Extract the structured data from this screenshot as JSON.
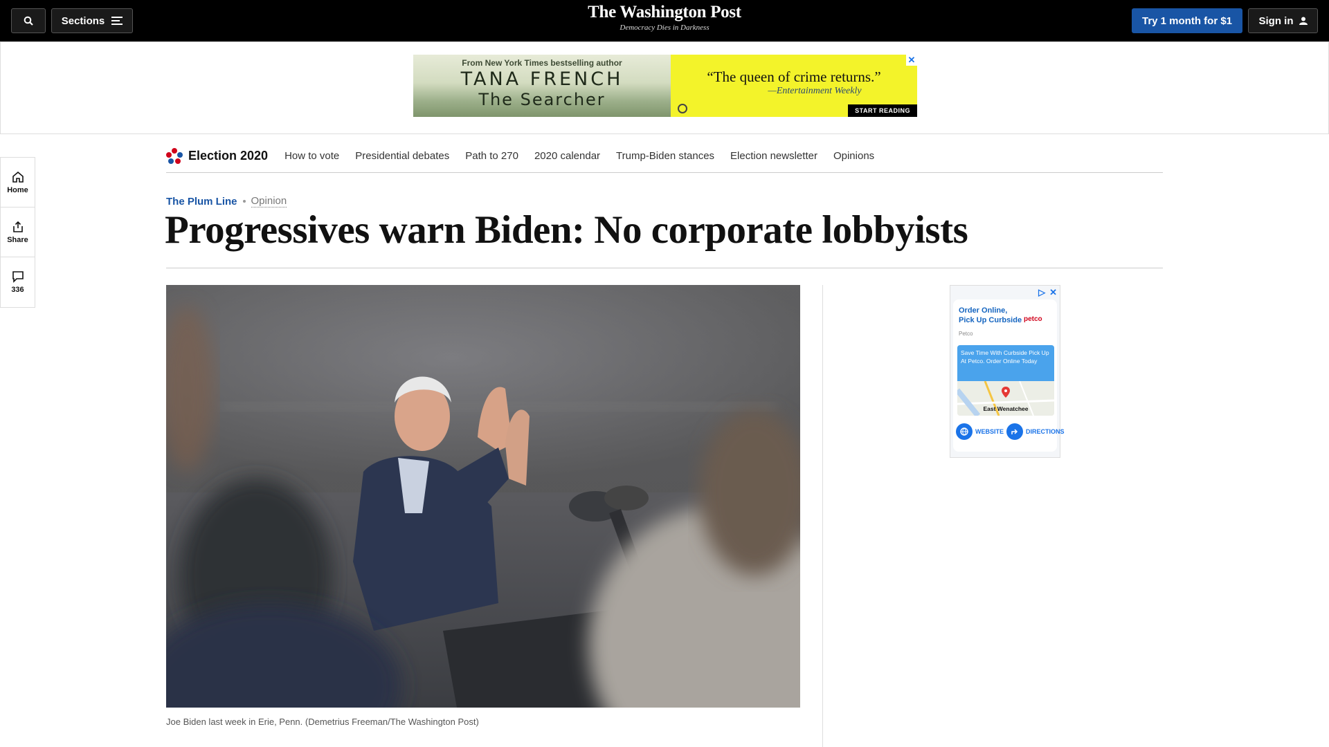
{
  "topbar": {
    "sections_label": "Sections",
    "logo": "The Washington Post",
    "tagline": "Democracy Dies in Darkness",
    "try_label": "Try 1 month for $1",
    "signin_label": "Sign in"
  },
  "ad_banner": {
    "from_text": "From New York Times bestselling author",
    "author": "TANA FRENCH",
    "book": "The Searcher",
    "quote": "“The queen of crime returns.”",
    "attribution": "—Entertainment Weekly",
    "cta": "START READING",
    "close": "✕"
  },
  "section_nav": {
    "title": "Election 2020",
    "links": [
      "How to vote",
      "Presidential debates",
      "Path to 270",
      "2020 calendar",
      "Trump-Biden stances",
      "Election newsletter",
      "Opinions"
    ]
  },
  "rail": {
    "home": "Home",
    "share": "Share",
    "comments": "336"
  },
  "article": {
    "column": "The Plum Line",
    "label": "Opinion",
    "headline": "Progressives warn Biden: No corporate lobbyists",
    "caption": "Joe Biden last week in Erie, Penn. (Demetrius Freeman/The Washington Post)"
  },
  "side_ad": {
    "headline_line1": "Order Online,",
    "headline_line2": "Pick Up Curbside",
    "brand": "petco",
    "advertiser": "Petco",
    "promo": "Save Time With Curbside Pick Up At Petco. Order Online Today",
    "place": "East Wenatchee",
    "website": "WEBSITE",
    "directions": "DIRECTIONS"
  },
  "colors": {
    "accent_blue": "#1955a5",
    "topbar": "#000000",
    "ad_yellow": "#f3f32a"
  }
}
